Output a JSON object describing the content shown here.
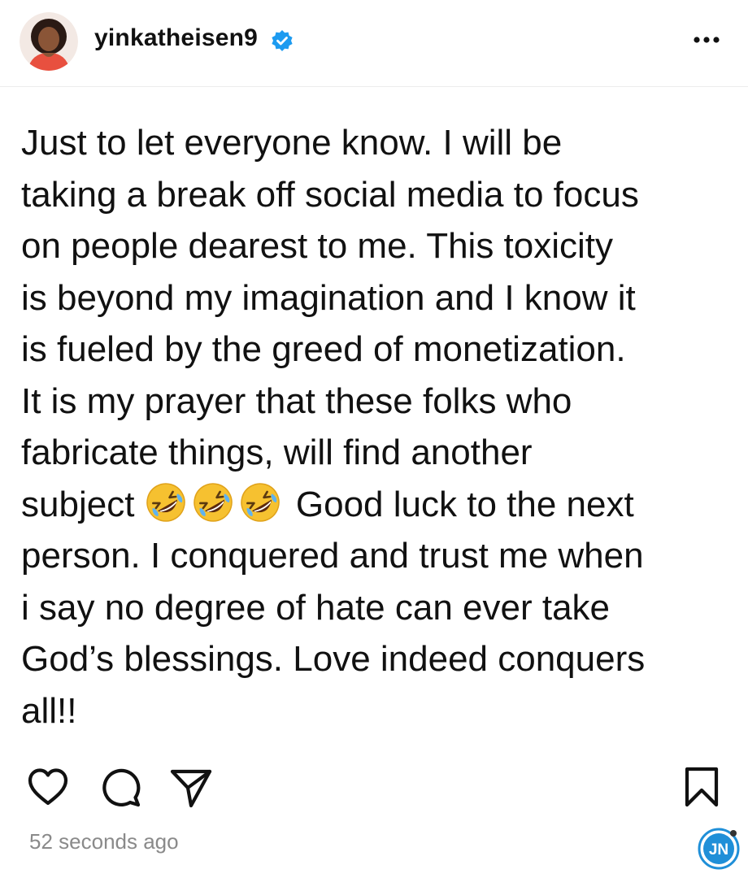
{
  "post": {
    "username": "yinkatheisen9",
    "verified": true,
    "more_icon": "more-horizontal-icon",
    "text_lines": [
      "Just to let everyone know. I will be",
      "taking a break off social media to focus",
      "on people dearest to me. This toxicity",
      "is beyond my imagination and I know it",
      "is fueled by the greed of monetization.",
      "It is my prayer that these folks who",
      "fabricate things, will find another"
    ],
    "emoji_line": {
      "before": "subject",
      "emoji": "rolling-on-floor-laughing",
      "emoji_count": 3,
      "after": "Good luck to the next"
    },
    "text_lines_end": [
      "person. I conquered and trust me when",
      "i say no degree of hate can ever take",
      "God’s blessings. Love indeed conquers",
      "all!!"
    ],
    "timestamp": "52 seconds ago"
  },
  "actions": {
    "like_icon": "heart-icon",
    "comment_icon": "comment-icon",
    "share_icon": "send-icon",
    "save_icon": "bookmark-icon"
  },
  "watermark": {
    "text": "JN"
  },
  "colors": {
    "verified_blue": "#1d9bf0",
    "timestamp_gray": "#8a8a8a",
    "watermark_blue": "#1f8fd8"
  }
}
